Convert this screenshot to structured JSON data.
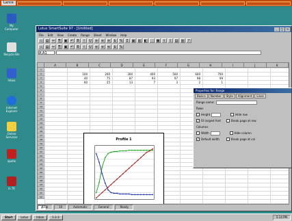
{
  "top_bar": {
    "start_label": "Lance"
  },
  "desktop_icons": [
    {
      "label": "My Computer",
      "icon": "computer-icon",
      "color": "#2a5cc0"
    },
    {
      "label": "Recycle Bin",
      "icon": "recycle-bin-icon",
      "color": "#e0e0e0"
    },
    {
      "label": "Inbox",
      "icon": "inbox-icon",
      "color": "#3060d0"
    },
    {
      "label": "Internet Explorer",
      "icon": "internet-explorer-icon",
      "color": "#1e6fd9"
    },
    {
      "label": "Online Services",
      "icon": "folder-icon",
      "color": "#f0d040"
    },
    {
      "label": "apollo",
      "icon": "document-icon",
      "color": "#c02020"
    },
    {
      "label": "in.TE",
      "icon": "app-icon",
      "color": "#b02020"
    }
  ],
  "window": {
    "title": "Lotus SmartSuite 97 - [Untitled]",
    "menus": [
      "File",
      "Edit",
      "View",
      "Create",
      "Range",
      "Sheet",
      "Window",
      "Help"
    ],
    "formula_bar": {
      "cell_ref": "A:A1"
    },
    "column_headers": [
      "A",
      "B",
      "C",
      "D",
      "E",
      "F",
      "G",
      "H",
      "I",
      "J",
      "K"
    ],
    "row_headers": [
      "1",
      "2",
      "3",
      "4",
      "5",
      "6",
      "7",
      "8",
      "9",
      "10",
      "11",
      "12",
      "13",
      "14",
      "15",
      "16",
      "17",
      "18",
      "19",
      "20",
      "21",
      "22",
      "23",
      "24",
      "25",
      "26",
      "27",
      "28",
      "29",
      "30",
      "31",
      "32"
    ],
    "sheet_tabs": [
      "A"
    ],
    "status": [
      "Arial",
      "10",
      "Automatic",
      "General",
      "Ready"
    ]
  },
  "cells": {
    "row1": [
      "100",
      "200",
      "300",
      "400",
      "500",
      "600",
      "700"
    ],
    "row2": [
      "40",
      "75",
      "87",
      "93",
      "97",
      "98",
      "99"
    ],
    "row3": [
      "60",
      "25",
      "13",
      "7",
      "3",
      "2",
      "1"
    ]
  },
  "chart_data": {
    "type": "line",
    "title": "Profile 1",
    "xlabel": "",
    "ylabel": "",
    "series": [
      {
        "values": [
          10,
          25,
          48,
          62,
          68,
          70,
          71,
          71,
          72,
          72,
          72,
          73,
          73,
          73,
          73,
          73,
          73,
          73,
          73,
          73
        ],
        "color": "#22aa22"
      },
      {
        "values": [
          68,
          55,
          38,
          24,
          14,
          10,
          9,
          9,
          8,
          8,
          8,
          8,
          7,
          7,
          7,
          7,
          7,
          7,
          7,
          7
        ],
        "color": "#2233aa"
      },
      {
        "values": [
          2,
          6,
          10,
          14,
          18,
          22,
          26,
          30,
          34,
          38,
          42,
          46,
          50,
          54,
          58,
          62,
          66,
          70,
          72,
          75
        ],
        "color": "#aa2222"
      }
    ],
    "ylim": [
      0,
      80
    ]
  },
  "panel": {
    "title": "Properties for: Range",
    "tabs": [
      "Basics",
      "Number",
      "Style",
      "Alignment",
      "Lines"
    ],
    "range_name_label": "Range name:",
    "rows_label": "Rows",
    "height_label": "Height",
    "fit_label": "Fit largest font",
    "hide_rows_label": "Hide row",
    "break_page_label": "Break page at row",
    "columns_label": "Columns",
    "width_label": "Width",
    "default_width_label": "Default width",
    "hide_col_label": "Hide column",
    "break_col_label": "Break page at col"
  },
  "taskbar": {
    "start_label": "Start",
    "tasks": [
      "Lotus",
      "Inbox",
      "1-2-3"
    ],
    "clock": "5:14 PM"
  }
}
